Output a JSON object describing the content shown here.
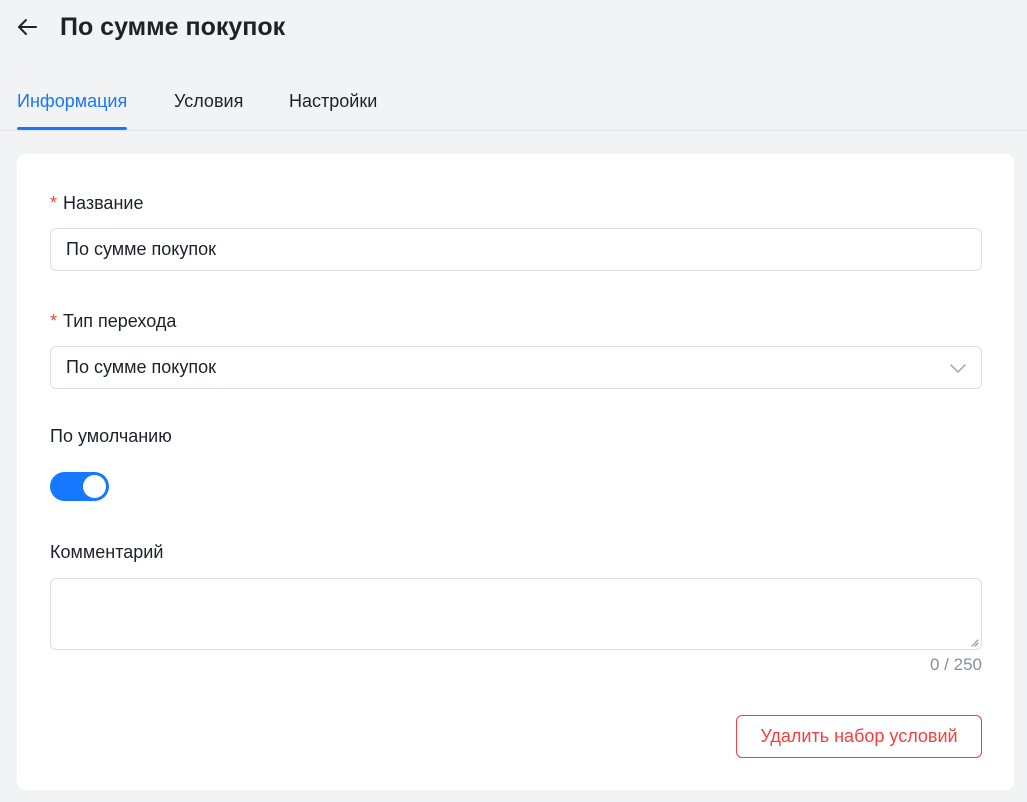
{
  "header": {
    "back_icon": "arrow-left-icon",
    "title": "По сумме покупок"
  },
  "tabs": [
    {
      "label": "Информация",
      "active": true
    },
    {
      "label": "Условия",
      "active": false
    },
    {
      "label": "Настройки",
      "active": false
    }
  ],
  "form": {
    "name": {
      "required": true,
      "label": "Название",
      "value": "По сумме покупок"
    },
    "transition_type": {
      "required": true,
      "label": "Тип перехода",
      "value": "По сумме покупок",
      "icon": "chevron-down-icon"
    },
    "default": {
      "label": "По умолчанию",
      "enabled": true
    },
    "comment": {
      "label": "Комментарий",
      "value": "",
      "counter": "0 / 250"
    },
    "delete_button": "Удалить набор условий"
  },
  "colors": {
    "accent": "#1677ff",
    "danger": "#f53f3f",
    "background": "#f2f3f5",
    "muted": "#86909c"
  }
}
